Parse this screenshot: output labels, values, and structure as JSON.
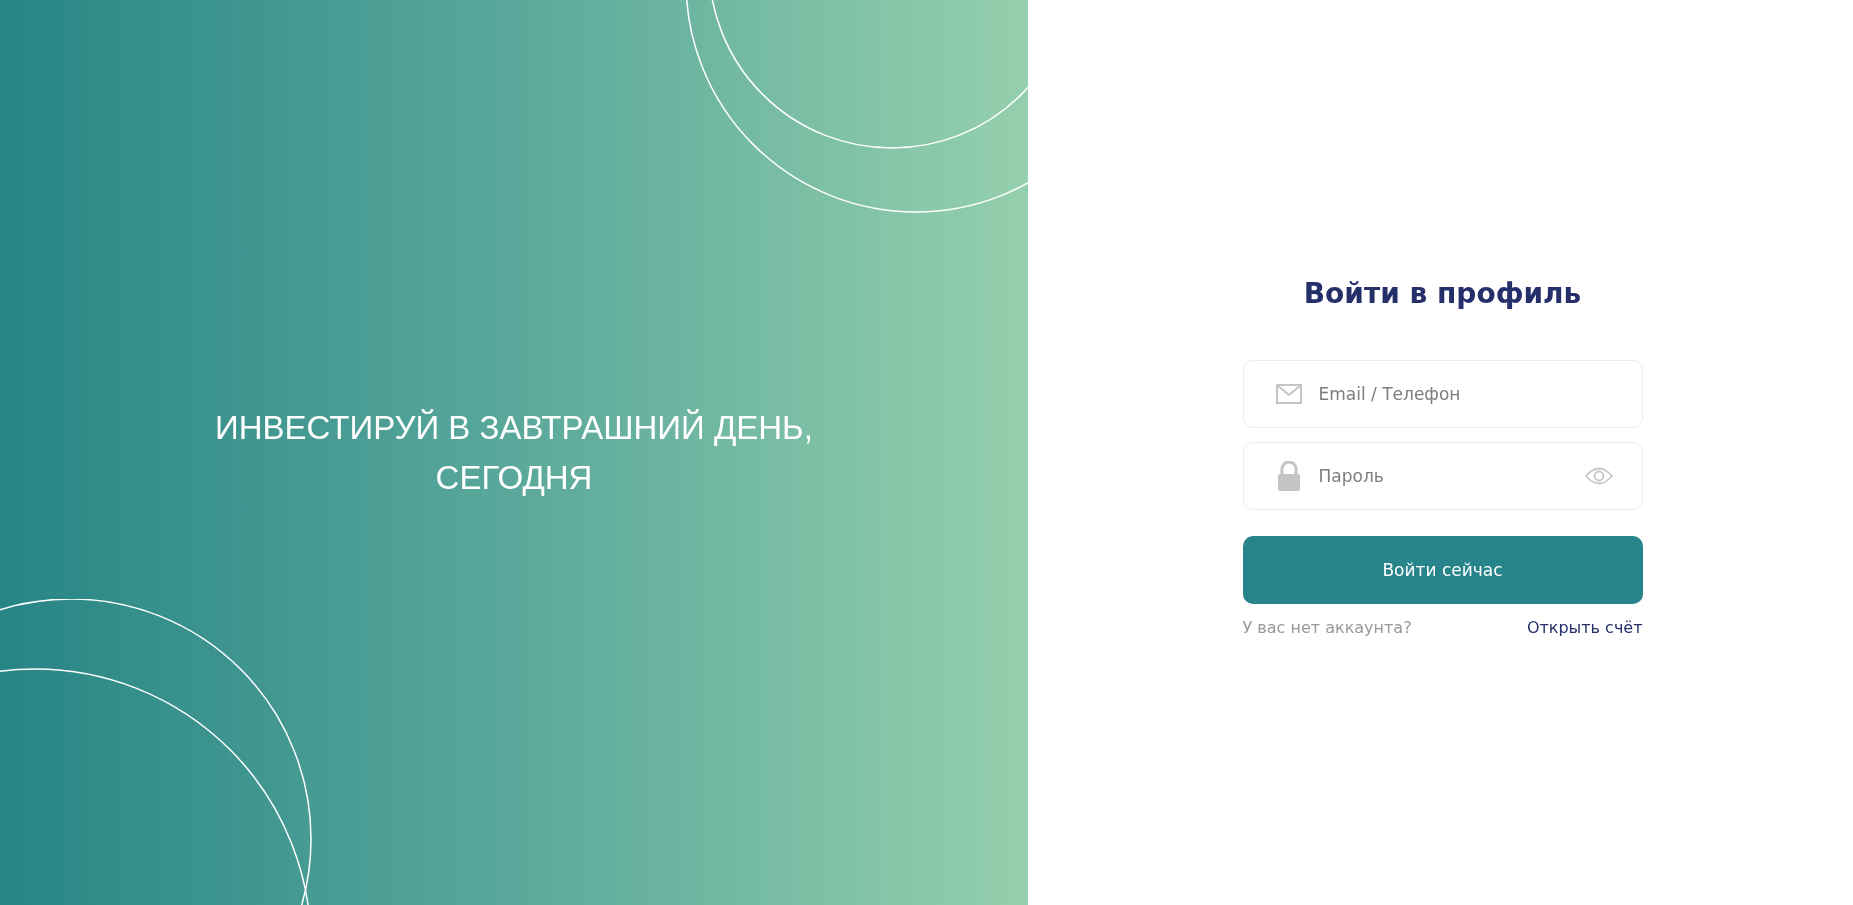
{
  "hero": {
    "headline": "ИНВЕСТИРУЙ В ЗАВТРАШНИЙ ДЕНЬ, СЕГОДНЯ"
  },
  "login": {
    "title": "Войти в профиль",
    "fields": [
      {
        "kind": "email",
        "placeholder": "Email / Телефон"
      },
      {
        "kind": "password",
        "placeholder": "Пароль"
      }
    ],
    "submit": "Войти сейчас",
    "prompt": "У вас нет аккаунта?",
    "signup_link": "Открыть счёт"
  }
}
